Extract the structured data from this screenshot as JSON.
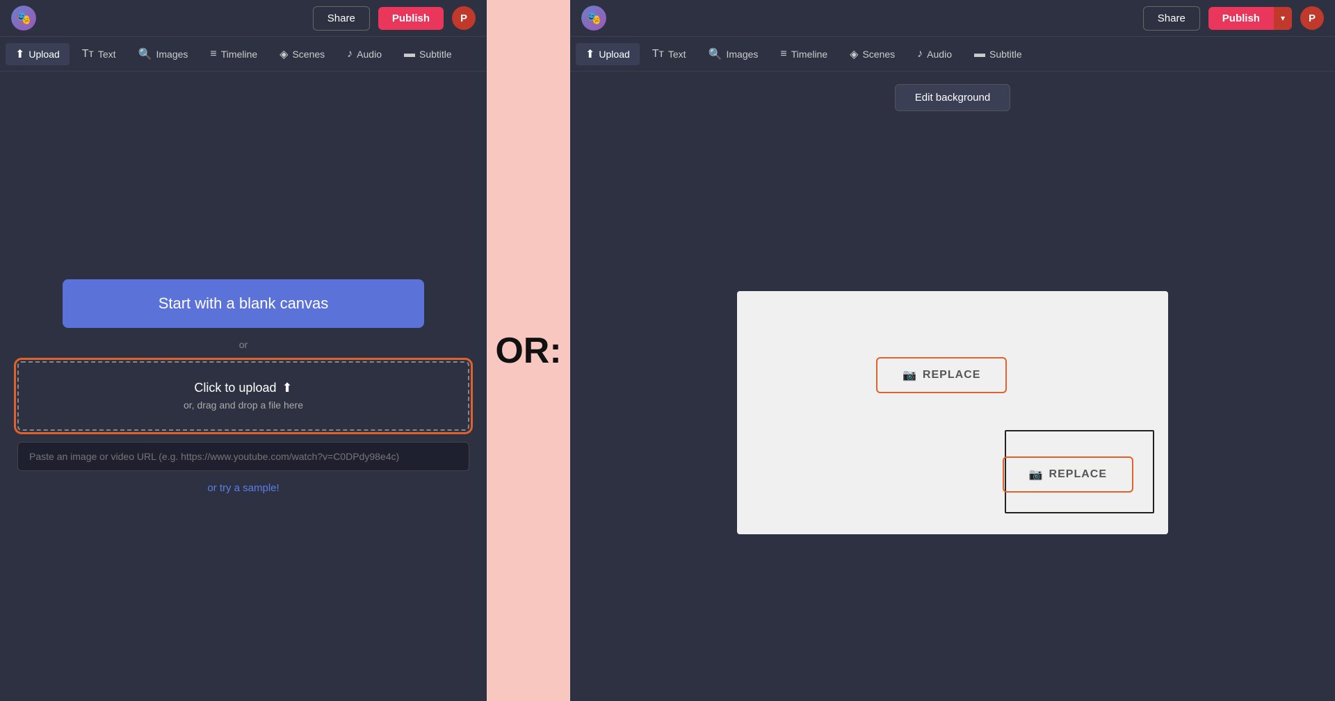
{
  "left": {
    "header": {
      "share_label": "Share",
      "publish_label": "Publish",
      "avatar_label": "P"
    },
    "toolbar": {
      "items": [
        {
          "id": "upload",
          "icon": "⬆",
          "label": "Upload"
        },
        {
          "id": "text",
          "icon": "T",
          "label": "Text"
        },
        {
          "id": "images",
          "icon": "🔍",
          "label": "Images"
        },
        {
          "id": "timeline",
          "icon": "≡",
          "label": "Timeline"
        },
        {
          "id": "scenes",
          "icon": "◈",
          "label": "Scenes"
        },
        {
          "id": "audio",
          "icon": "♪",
          "label": "Audio"
        },
        {
          "id": "subtitle",
          "icon": "▬",
          "label": "Subtitle"
        }
      ]
    },
    "main": {
      "blank_canvas_label": "Start with a blank canvas",
      "or_text": "or",
      "upload_zone": {
        "click_label": "Click to upload",
        "drag_label": "or, drag and drop a file here"
      },
      "url_placeholder": "Paste an image or video URL (e.g. https://www.youtube.com/watch?v=C0DPdy98e4c)",
      "try_sample_label": "or try a sample!"
    }
  },
  "separator": {
    "label": "OR:"
  },
  "right": {
    "header": {
      "share_label": "Share",
      "publish_label": "Publish",
      "avatar_label": "P"
    },
    "toolbar": {
      "items": [
        {
          "id": "upload",
          "icon": "⬆",
          "label": "Upload"
        },
        {
          "id": "text",
          "icon": "T",
          "label": "Text"
        },
        {
          "id": "images",
          "icon": "🔍",
          "label": "Images"
        },
        {
          "id": "timeline",
          "icon": "≡",
          "label": "Timeline"
        },
        {
          "id": "scenes",
          "icon": "◈",
          "label": "Scenes"
        },
        {
          "id": "audio",
          "icon": "♪",
          "label": "Audio"
        },
        {
          "id": "subtitle",
          "icon": "▬",
          "label": "Subtitle"
        }
      ]
    },
    "edit_bg_label": "Edit background",
    "replace_label": "REPLACE",
    "replace2_label": "REPLACE"
  }
}
